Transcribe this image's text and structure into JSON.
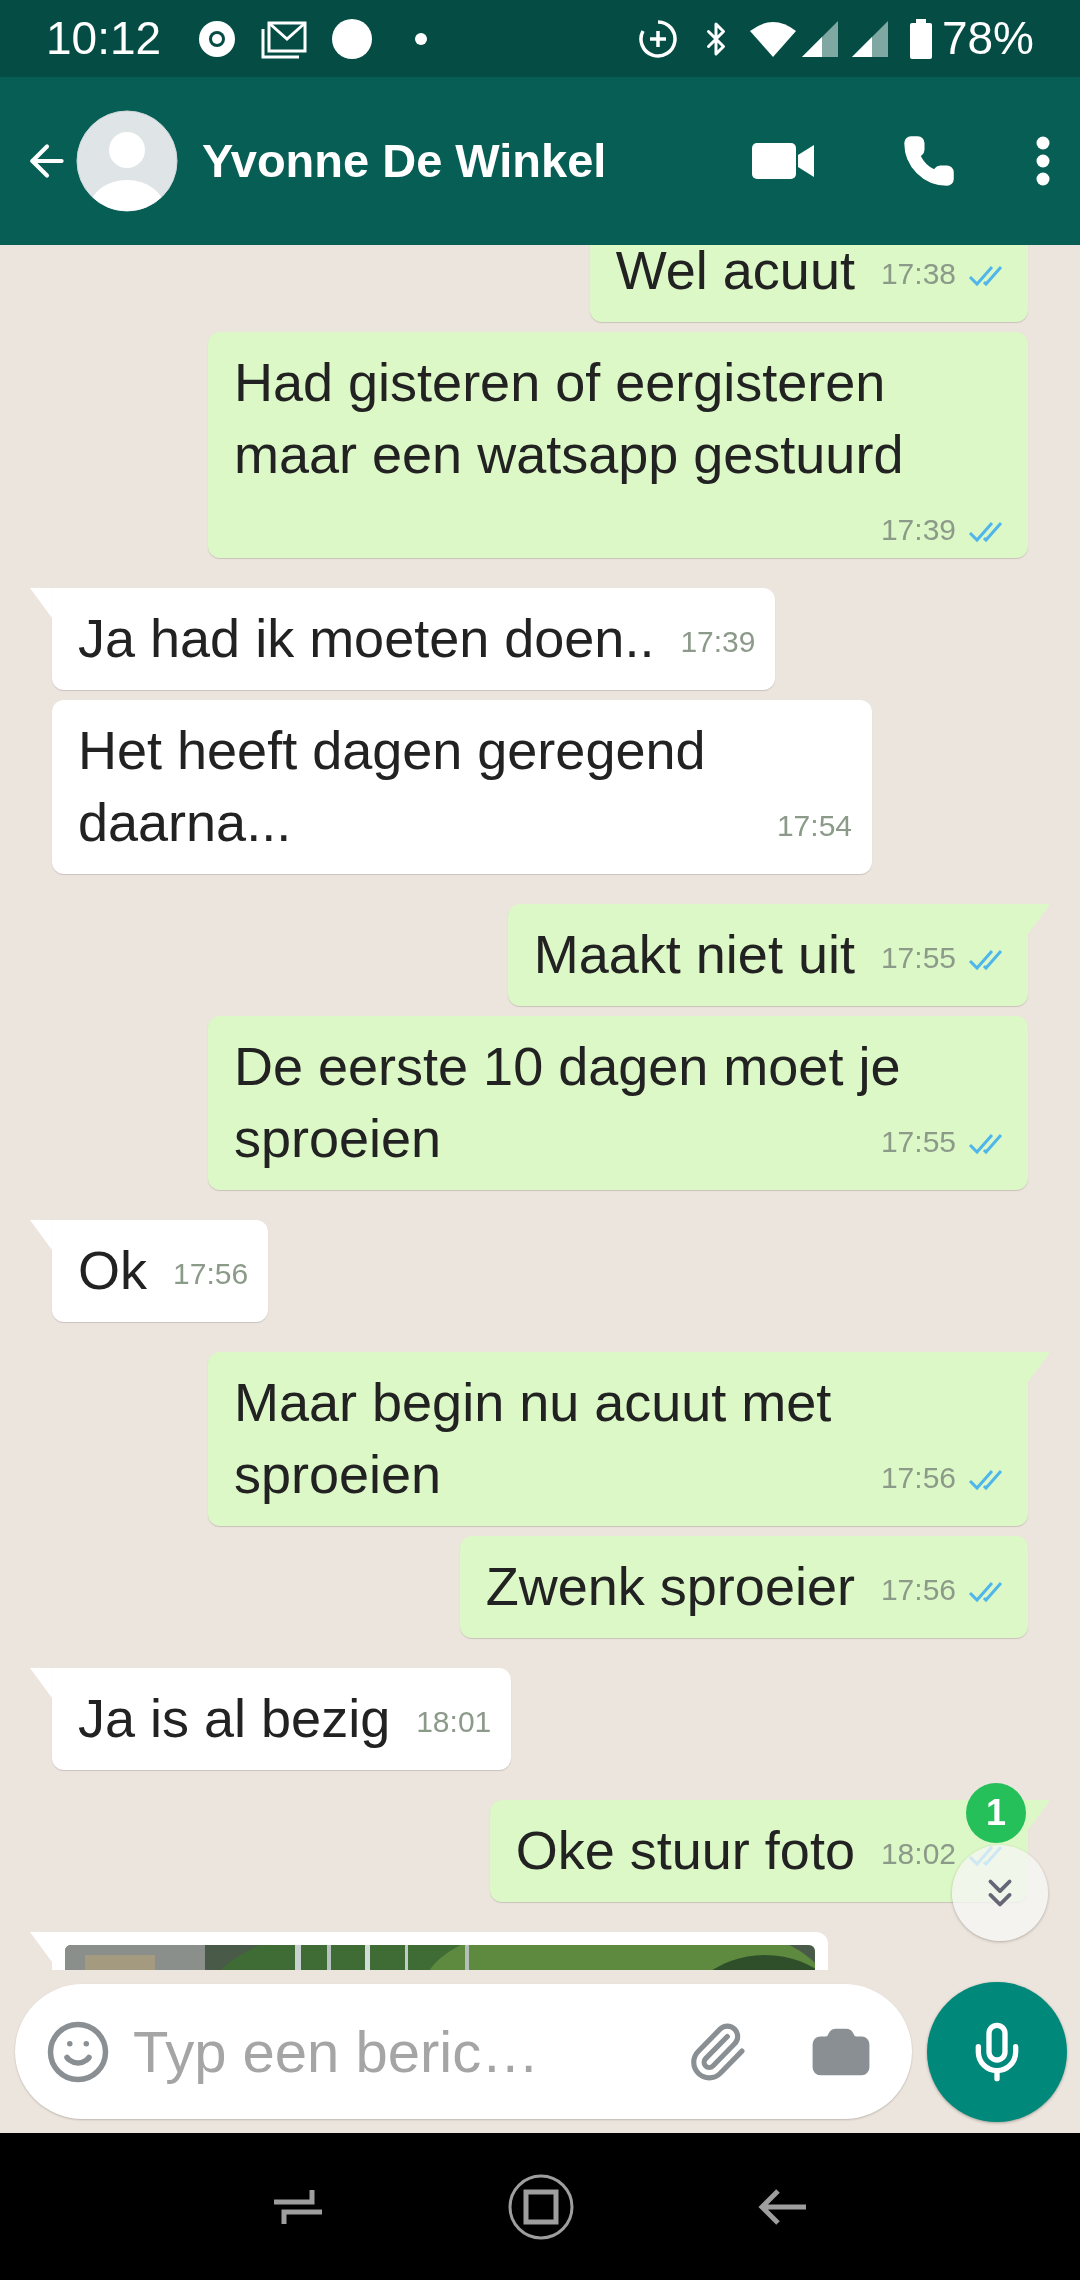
{
  "status_bar": {
    "time": "10:12",
    "battery": "78%"
  },
  "header": {
    "contact_name": "Yvonne De Winkel"
  },
  "messages": [
    {
      "kind": "outgoing",
      "text": "Wel acuut",
      "time": "17:38",
      "read": true,
      "tail": false
    },
    {
      "kind": "outgoing",
      "text": "Had gisteren of eergisteren maar een watsapp gestuurd",
      "time": "17:39",
      "read": true,
      "tail": false
    },
    {
      "kind": "incoming",
      "text": "Ja had ik moeten doen..",
      "time": "17:39",
      "tail": true
    },
    {
      "kind": "incoming",
      "text": "Het heeft dagen geregend daarna...",
      "time": "17:54",
      "tail": false
    },
    {
      "kind": "outgoing",
      "text": "Maakt niet uit",
      "time": "17:55",
      "read": true,
      "tail": true
    },
    {
      "kind": "outgoing",
      "text": "De eerste 10 dagen moet je sproeien",
      "time": "17:55",
      "read": true,
      "tail": false
    },
    {
      "kind": "incoming",
      "text": "Ok",
      "time": "17:56",
      "tail": true
    },
    {
      "kind": "outgoing",
      "text": "Maar begin nu acuut met sproeien",
      "time": "17:56",
      "read": true,
      "tail": true
    },
    {
      "kind": "outgoing",
      "text": "Zwenk sproeier",
      "time": "17:56",
      "read": true,
      "tail": false
    },
    {
      "kind": "incoming",
      "text": "Ja is al bezig",
      "time": "18:01",
      "tail": true
    },
    {
      "kind": "outgoing",
      "text": "Oke stuur foto",
      "time": "18:02",
      "read": true,
      "tail": true
    },
    {
      "kind": "incoming-photo",
      "tail": true
    }
  ],
  "scroll_button": {
    "badge": "1"
  },
  "composer": {
    "placeholder": "Typ een beric…"
  }
}
